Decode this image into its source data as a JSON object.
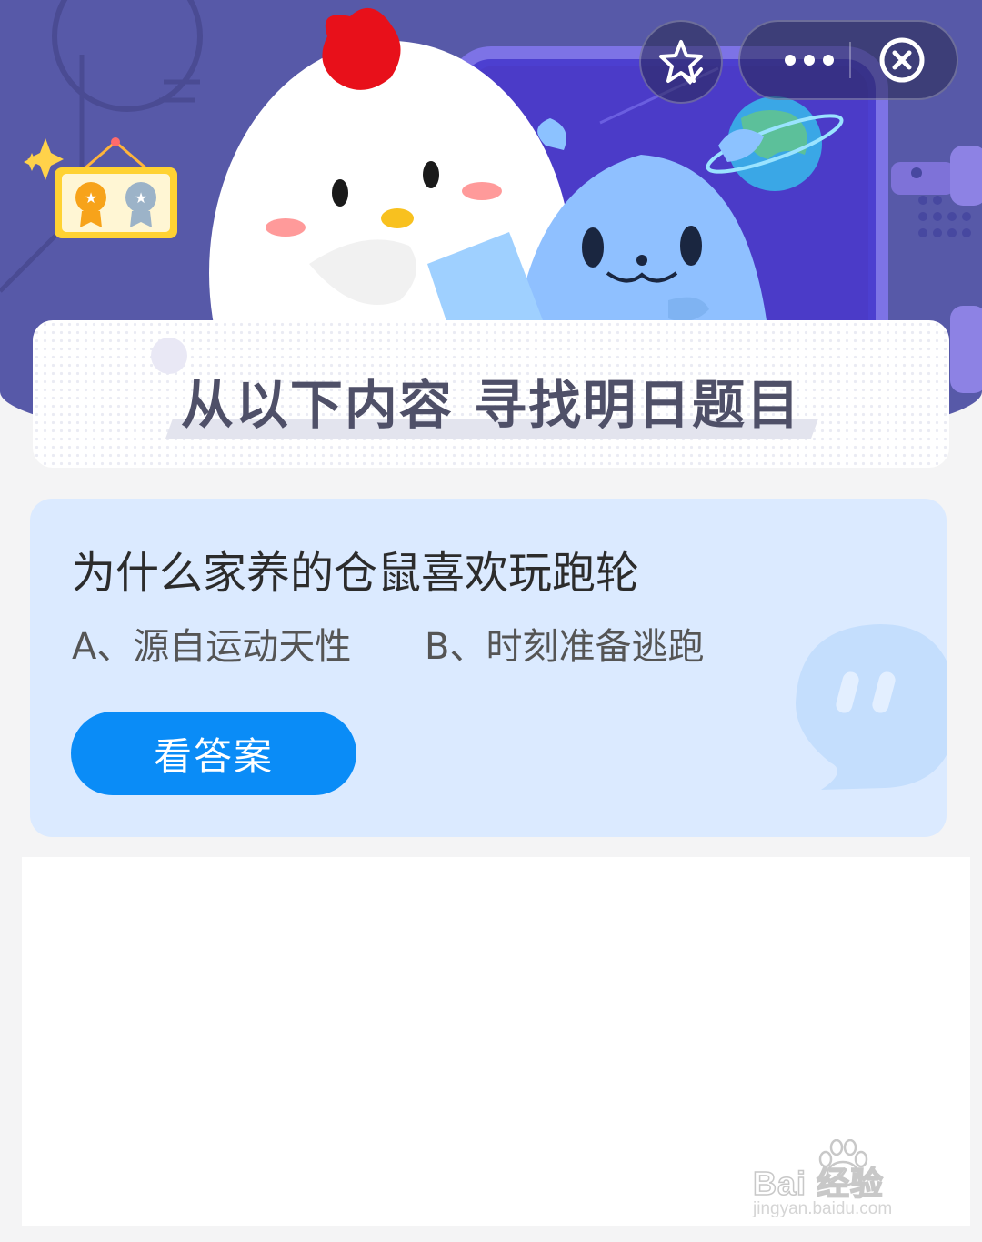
{
  "banner": {
    "title": "从以下内容  寻找明日题目"
  },
  "controls": {
    "favorite_icon": "star-check-icon",
    "more_icon": "more-dots-icon",
    "close_icon": "close-circle-icon"
  },
  "question": {
    "title": "为什么家养的仓鼠喜欢玩跑轮",
    "option_a": "A、源自运动天性",
    "option_b": "B、时刻准备逃跑",
    "answer_button": "看答案"
  },
  "watermark": {
    "brand": "Bai   经验",
    "url": "jingyan.baidu.com"
  },
  "colors": {
    "hero_background": "#5759a8",
    "card_background": "#dbeaff",
    "button": "#0a8cf7",
    "page_background": "#f4f4f5"
  }
}
